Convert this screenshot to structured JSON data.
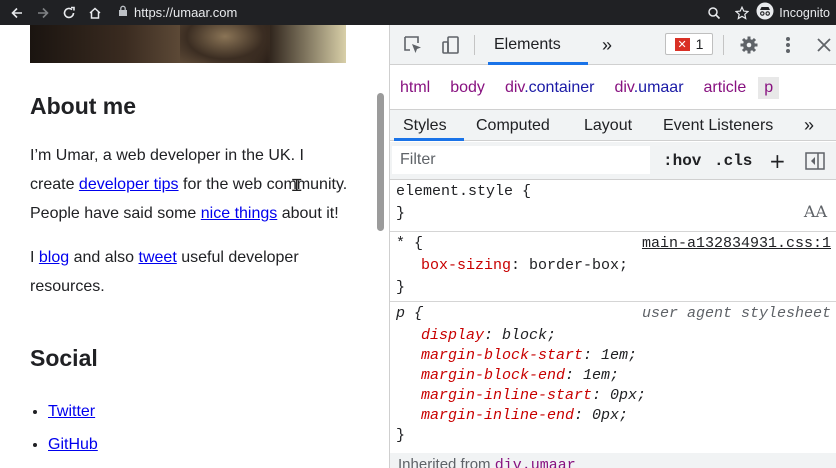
{
  "browser": {
    "url": "https://umaar.com",
    "incognito_label": "Incognito",
    "icons": [
      "back-icon",
      "forward-icon",
      "reload-icon",
      "home-icon",
      "lock-icon",
      "zoom-icon",
      "star-icon",
      "incognito-icon"
    ]
  },
  "page": {
    "about_heading": "About me",
    "p1": {
      "text_a": "I’m Umar, a web developer in the UK. I create ",
      "link_a": "developer tips",
      "text_b": " for the web community. People have said some ",
      "link_b": "nice things",
      "text_c": " about it!"
    },
    "p2": {
      "text_a": "I ",
      "link_a": "blog",
      "text_b": " and also ",
      "link_b": "tweet",
      "text_c": " useful developer resources."
    },
    "social_heading": "Social",
    "social_links": [
      "Twitter",
      "GitHub"
    ]
  },
  "devtools": {
    "main_tab": "Elements",
    "more_tabs": "»",
    "error_count": "1",
    "breadcrumbs": [
      {
        "tag": "html",
        "cls": ""
      },
      {
        "tag": "body",
        "cls": ""
      },
      {
        "tag": "div",
        "cls": ".container"
      },
      {
        "tag": "div",
        "cls": ".umaar"
      },
      {
        "tag": "article",
        "cls": ""
      },
      {
        "tag": "p",
        "cls": ""
      }
    ],
    "subtabs": [
      "Styles",
      "Computed",
      "Layout",
      "Event Listeners",
      "»"
    ],
    "active_subtab": "Styles",
    "filter_placeholder": "Filter",
    "hov": ":hov",
    "cls": ".cls",
    "plus": "+",
    "rules": {
      "element_style": {
        "selector": "element.style {",
        "close": "}"
      },
      "universal": {
        "selector": "* {",
        "source": "main-a132834931.css:1",
        "decls": [
          {
            "prop": "box-sizing",
            "value": "border-box;"
          }
        ],
        "close": "}"
      },
      "p_rule": {
        "selector": "p {",
        "source": "user agent stylesheet",
        "decls": [
          {
            "prop": "display",
            "value": "block;"
          },
          {
            "prop": "margin-block-start",
            "value": "1em;"
          },
          {
            "prop": "margin-block-end",
            "value": "1em;"
          },
          {
            "prop": "margin-inline-start",
            "value": "0px;"
          },
          {
            "prop": "margin-inline-end",
            "value": "0px;"
          }
        ],
        "close": "}"
      }
    },
    "inherited_label": "Inherited from ",
    "inherited_element": "div.umaar",
    "font_icon_label": "AA"
  }
}
